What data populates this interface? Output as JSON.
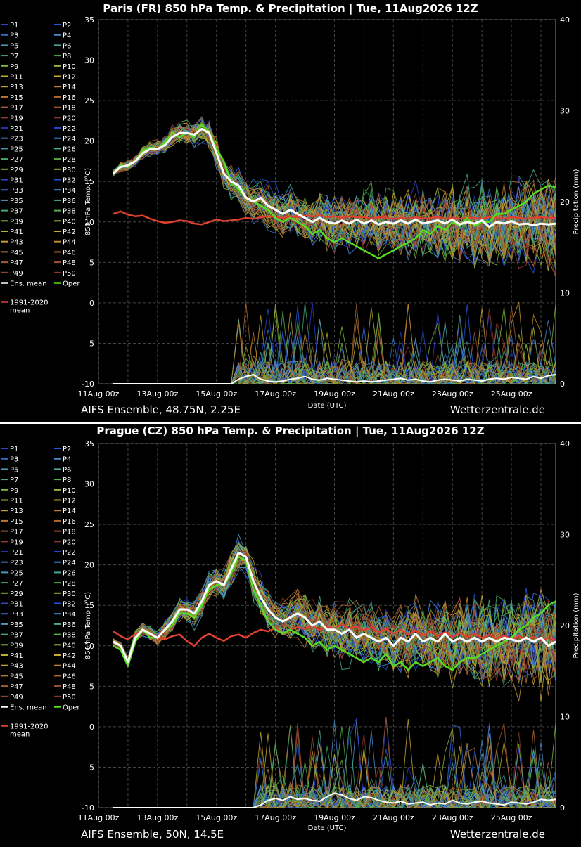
{
  "chart_data": [
    {
      "type": "line",
      "title": "Paris  (FR)  850 hPa Temp. & Precipitation | Tue, 11Aug2026 12Z",
      "xlabel": "Date (UTC)",
      "ylabel": "850 hPa Temp. (°C)",
      "y2label": "Precipitation (mm)",
      "footer_left": "AIFS Ensemble, 48.75N, 2.25E",
      "footer_right": "Wetterzentrale.de",
      "x_ticks": [
        "11Aug 00z",
        "13Aug 00z",
        "15Aug 00z",
        "17Aug 00z",
        "19Aug 00z",
        "21Aug 00z",
        "23Aug 00z",
        "25Aug 00z"
      ],
      "x_range": [
        "11Aug 00z",
        "26Aug 12z"
      ],
      "ylim": [
        -10,
        35
      ],
      "y2lim": [
        0,
        40
      ],
      "y_ticks": [
        35,
        30,
        25,
        20,
        15,
        10,
        5,
        0,
        -5,
        -10
      ],
      "y2_ticks": [
        40,
        30,
        20,
        10,
        0
      ],
      "grid": true,
      "legend_position": "left",
      "x": [
        "11Aug 12z",
        "11Aug 18z",
        "12Aug 00z",
        "12Aug 06z",
        "12Aug 12z",
        "12Aug 18z",
        "13Aug 00z",
        "13Aug 06z",
        "13Aug 12z",
        "13Aug 18z",
        "14Aug 00z",
        "14Aug 06z",
        "14Aug 12z",
        "14Aug 18z",
        "15Aug 00z",
        "15Aug 06z",
        "15Aug 12z",
        "15Aug 18z",
        "16Aug 00z",
        "16Aug 06z",
        "16Aug 12z",
        "16Aug 18z",
        "17Aug 00z",
        "17Aug 06z",
        "17Aug 12z",
        "17Aug 18z",
        "18Aug 00z",
        "18Aug 06z",
        "18Aug 12z",
        "18Aug 18z",
        "19Aug 00z",
        "19Aug 06z",
        "19Aug 12z",
        "19Aug 18z",
        "20Aug 00z",
        "20Aug 06z",
        "20Aug 12z",
        "20Aug 18z",
        "21Aug 00z",
        "21Aug 06z",
        "21Aug 12z",
        "21Aug 18z",
        "22Aug 00z",
        "22Aug 06z",
        "22Aug 12z",
        "22Aug 18z",
        "23Aug 00z",
        "23Aug 06z",
        "23Aug 12z",
        "23Aug 18z",
        "24Aug 00z",
        "24Aug 06z",
        "24Aug 12z",
        "24Aug 18z",
        "25Aug 00z",
        "25Aug 06z",
        "25Aug 12z",
        "25Aug 18z",
        "26Aug 00z",
        "26Aug 06z",
        "26Aug 12z"
      ],
      "series": [
        {
          "name": "Ens. mean",
          "color": "#ffffff",
          "values": [
            16,
            16.8,
            17,
            17.5,
            18.5,
            19,
            19,
            19.5,
            20.5,
            21,
            21,
            20.8,
            21.5,
            21,
            18.5,
            16,
            15,
            14.5,
            13,
            12.5,
            13,
            12,
            11.5,
            11,
            11.5,
            11,
            10.5,
            10,
            10.5,
            10,
            9.8,
            10.2,
            9.8,
            10.3,
            9.8,
            10.2,
            9.7,
            10,
            9.8,
            10.2,
            9.8,
            10.3,
            9.8,
            10,
            10.2,
            9.8,
            10.3,
            9.7,
            10,
            9.8,
            10.2,
            9.4,
            10,
            9.8,
            10.1,
            9.7,
            9.8,
            9.6,
            9.8,
            9.7,
            9.8
          ]
        },
        {
          "name": "Oper",
          "color": "#55dd22",
          "values": [
            15.8,
            17,
            16.8,
            17.5,
            18.8,
            19.2,
            19,
            19.8,
            21,
            20.5,
            21,
            20.5,
            22,
            21.2,
            19,
            17.5,
            15,
            14,
            13,
            12.5,
            12,
            11.5,
            10.5,
            10,
            10.5,
            10,
            9.5,
            8.5,
            9,
            8,
            7.5,
            8,
            7.5,
            7,
            6.5,
            6,
            5.5,
            6,
            6.5,
            7,
            7.5,
            8,
            9,
            8.5,
            9.5,
            9,
            10,
            9.5,
            10.5,
            9.5,
            10,
            10,
            11,
            11,
            11.5,
            12,
            12.5,
            13.5,
            14,
            14.5,
            14.3
          ]
        },
        {
          "name": "1991-2020 mean",
          "color": "#e04030",
          "values": [
            11,
            11.3,
            10.9,
            10.7,
            10.8,
            10.4,
            10.1,
            9.9,
            10,
            10.2,
            10.1,
            9.8,
            9.7,
            10,
            10.3,
            10.1,
            10.2,
            10.3,
            10.5,
            10.4,
            10.6,
            10.7,
            10.6,
            10.5,
            10.7,
            10.6,
            10.8,
            10.7,
            10.8,
            10.6,
            10.7,
            10.5,
            10.7,
            10.6,
            10.6,
            10.4,
            10.6,
            10.5,
            10.4,
            10.5,
            10.4,
            10.6,
            10.4,
            10.5,
            10.6,
            10.4,
            10.5,
            10.4,
            10.5,
            10.5,
            10.4,
            10.6,
            10.5,
            10.4,
            10.6,
            10.5,
            10.4,
            10.5,
            10.6,
            10.5,
            10.5
          ]
        },
        {
          "name": "Ens. mean precipitation",
          "color": "#ffffff",
          "axis": "y2",
          "values": [
            0,
            0,
            0,
            0,
            0,
            0,
            0,
            0,
            0,
            0,
            0,
            0,
            0,
            0,
            0,
            0,
            0,
            0.5,
            0.8,
            1,
            0.5,
            0.3,
            0.2,
            0.3,
            0.5,
            0.6,
            0.8,
            0.5,
            0.4,
            0.6,
            0.5,
            0.4,
            0.3,
            0.2,
            0.3,
            0.2,
            0.3,
            0.4,
            0.5,
            0.6,
            0.4,
            0.5,
            0.3,
            0.2,
            0.4,
            0.5,
            0.4,
            0.3,
            0.5,
            0.4,
            0.3,
            0.5,
            0.6,
            0.5,
            0.7,
            0.6,
            0.5,
            0.8,
            0.6,
            0.9,
            1
          ]
        }
      ]
    },
    {
      "type": "line",
      "title": "Prague  (CZ)  850 hPa Temp. & Precipitation | Tue, 11Aug2026 12Z",
      "xlabel": "Date (UTC)",
      "ylabel": "850 hPa Temp. (°C)",
      "y2label": "Precipitation (mm)",
      "footer_left": "AIFS Ensemble, 50N, 14.5E",
      "footer_right": "Wetterzentrale.de",
      "x_ticks": [
        "11Aug 00z",
        "13Aug 00z",
        "15Aug 00z",
        "17Aug 00z",
        "19Aug 00z",
        "21Aug 00z",
        "23Aug 00z",
        "25Aug 00z"
      ],
      "x_range": [
        "11Aug 00z",
        "26Aug 12z"
      ],
      "ylim": [
        -10,
        35
      ],
      "y2lim": [
        0,
        40
      ],
      "y_ticks": [
        35,
        30,
        25,
        20,
        15,
        10,
        5,
        0,
        -5,
        -10
      ],
      "y2_ticks": [
        40,
        30,
        20,
        10,
        0
      ],
      "grid": true,
      "legend_position": "left",
      "x": [
        "11Aug 12z",
        "11Aug 18z",
        "12Aug 00z",
        "12Aug 06z",
        "12Aug 12z",
        "12Aug 18z",
        "13Aug 00z",
        "13Aug 06z",
        "13Aug 12z",
        "13Aug 18z",
        "14Aug 00z",
        "14Aug 06z",
        "14Aug 12z",
        "14Aug 18z",
        "15Aug 00z",
        "15Aug 06z",
        "15Aug 12z",
        "15Aug 18z",
        "16Aug 00z",
        "16Aug 06z",
        "16Aug 12z",
        "16Aug 18z",
        "17Aug 00z",
        "17Aug 06z",
        "17Aug 12z",
        "17Aug 18z",
        "18Aug 00z",
        "18Aug 06z",
        "18Aug 12z",
        "18Aug 18z",
        "19Aug 00z",
        "19Aug 06z",
        "19Aug 12z",
        "19Aug 18z",
        "20Aug 00z",
        "20Aug 06z",
        "20Aug 12z",
        "20Aug 18z",
        "21Aug 00z",
        "21Aug 06z",
        "21Aug 12z",
        "21Aug 18z",
        "22Aug 00z",
        "22Aug 06z",
        "22Aug 12z",
        "22Aug 18z",
        "23Aug 00z",
        "23Aug 06z",
        "23Aug 12z",
        "23Aug 18z",
        "24Aug 00z",
        "24Aug 06z",
        "24Aug 12z",
        "24Aug 18z",
        "25Aug 00z",
        "25Aug 06z",
        "25Aug 12z",
        "25Aug 18z",
        "26Aug 00z",
        "26Aug 06z",
        "26Aug 12z"
      ],
      "series": [
        {
          "name": "Ens. mean",
          "color": "#ffffff",
          "values": [
            10.5,
            10,
            8,
            11,
            12,
            11.5,
            11,
            12,
            13,
            14.5,
            14.5,
            14,
            15.5,
            17.5,
            18,
            17.5,
            19.5,
            21.5,
            21,
            18,
            16,
            14.5,
            13.5,
            13,
            13.5,
            14,
            13.5,
            12.5,
            13,
            12,
            12,
            11.5,
            12,
            11,
            11.5,
            11,
            10.5,
            11,
            10,
            11,
            10.5,
            11.5,
            10.5,
            11,
            10.5,
            11.5,
            10.5,
            11,
            10.5,
            11,
            10.5,
            11,
            10.5,
            11,
            10.8,
            10.5,
            11,
            10.5,
            11,
            10,
            10.5
          ]
        },
        {
          "name": "Oper",
          "color": "#55dd22",
          "values": [
            10,
            9.5,
            7.5,
            10.5,
            12,
            11,
            11,
            12,
            12.5,
            14,
            14,
            13.5,
            15,
            17,
            17.5,
            17.5,
            19,
            21,
            20.5,
            17,
            15,
            13,
            12,
            11.5,
            12,
            11.5,
            11,
            10,
            10.5,
            9.5,
            10,
            9.5,
            9,
            8.5,
            8,
            8.5,
            8,
            9,
            7.5,
            8,
            7,
            8,
            7.5,
            8,
            8.5,
            7.5,
            7,
            8,
            8.5,
            8.5,
            9,
            9.5,
            10,
            10.5,
            11,
            12,
            12.5,
            13.5,
            14,
            15,
            15.5
          ]
        },
        {
          "name": "1991-2020 mean",
          "color": "#e04030",
          "values": [
            11.8,
            11.2,
            10.8,
            11.5,
            11.8,
            11.4,
            11,
            10.8,
            11.2,
            11.4,
            10.6,
            10,
            11,
            11.5,
            11,
            10.6,
            11.2,
            11.4,
            11,
            11.6,
            12,
            11.8,
            12.2,
            11.4,
            12,
            12.3,
            12.1,
            12.5,
            11.9,
            12.4,
            12.1,
            12.7,
            12.1,
            12.4,
            11.9,
            12.3,
            11.7,
            12.1,
            11.5,
            12,
            11.4,
            11.9,
            11.3,
            11.8,
            11.2,
            11.7,
            11.1,
            11.6,
            11.1,
            11.5,
            11,
            11.4,
            10.9,
            11.3,
            10.8,
            11.2,
            10.8,
            11.1,
            10.7,
            11,
            10.7
          ]
        },
        {
          "name": "Ens. mean precipitation",
          "color": "#ffffff",
          "axis": "y2",
          "values": [
            0,
            0,
            0,
            0,
            0,
            0,
            0,
            0,
            0,
            0,
            0,
            0,
            0,
            0,
            0,
            0,
            0,
            0,
            0,
            0,
            0.3,
            0.8,
            1,
            0.8,
            1.2,
            0.9,
            1,
            0.8,
            0.7,
            1.2,
            1.6,
            1.4,
            1,
            0.8,
            1.2,
            1.1,
            0.8,
            0.6,
            0.5,
            0.7,
            0.4,
            0.5,
            0.6,
            0.3,
            0.5,
            0.4,
            0.8,
            0.5,
            0.4,
            0.6,
            0.7,
            0.5,
            0.4,
            0.3,
            0.6,
            0.5,
            0.4,
            0.6,
            0.9,
            0.8,
            0.9
          ]
        }
      ]
    }
  ],
  "legend": {
    "members": [
      "P1",
      "P2",
      "P3",
      "P4",
      "P5",
      "P6",
      "P7",
      "P8",
      "P9",
      "P10",
      "P11",
      "P12",
      "P13",
      "P14",
      "P15",
      "P16",
      "P17",
      "P18",
      "P19",
      "P20",
      "P21",
      "P22",
      "P23",
      "P24",
      "P25",
      "P26",
      "P27",
      "P28",
      "P29",
      "P30",
      "P31",
      "P32",
      "P33",
      "P34",
      "P35",
      "P36",
      "P37",
      "P38",
      "P39",
      "P40",
      "P41",
      "P42",
      "P43",
      "P44",
      "P45",
      "P46",
      "P47",
      "P48",
      "P49",
      "P50"
    ],
    "member_colors": [
      "#3344cc",
      "#2255dd",
      "#3a6fd8",
      "#4a8ed0",
      "#4a98b8",
      "#4aa898",
      "#44a870",
      "#52b050",
      "#7ab838",
      "#9ab840",
      "#b8b030",
      "#c8a830",
      "#c89a30",
      "#c08830",
      "#b87a30",
      "#b06a30",
      "#a85a30",
      "#a05030",
      "#983c30",
      "#8a3428",
      "#2233aa",
      "#2244cc",
      "#3377cc",
      "#4488cc",
      "#4499bb",
      "#44aa99",
      "#44aa66",
      "#55aa44",
      "#77b033",
      "#99b033"
    ],
    "mean_label": "Ens. mean",
    "oper_label": "Oper",
    "clim_label": "1991-2020\nmean"
  }
}
